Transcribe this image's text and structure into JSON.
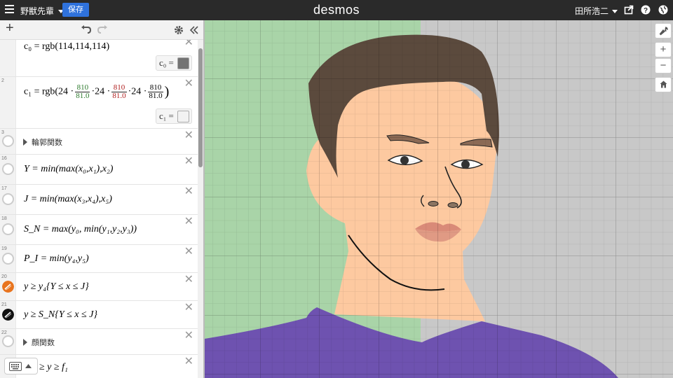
{
  "topbar": {
    "graph_name": "野獣先輩",
    "save_label": "保存",
    "logo": "desmos",
    "user_name": "田所浩二"
  },
  "expressions": [
    {
      "id": "",
      "latex": "c₀ = rgb(114,114,114)",
      "swatch_label": "c₀ =",
      "swatch_color": "#737373"
    },
    {
      "id": "2",
      "latex_prefix": "c₁ = rgb(24 ·",
      "frac_num": "810",
      "frac_den": "81.0",
      "latex_mid": "·24 ·",
      "latex_end": "·24 ·",
      "swatch_label": "c₁ =",
      "swatch_color": "#f2f2f2"
    },
    {
      "id": "3",
      "folder": "輪郭関数"
    },
    {
      "id": "16",
      "latex": "Y = min(max(x₀,x₁),x₂)"
    },
    {
      "id": "17",
      "latex": "J = min(max(x₃,x₄),x₅)"
    },
    {
      "id": "18",
      "latex": "S_N = max(y₀, min(y₁,y₂,y₃))"
    },
    {
      "id": "19",
      "latex": "P_I = min(y₄,y₅)"
    },
    {
      "id": "20",
      "latex": "y ≥ y₄{Y ≤ x ≤ J}",
      "icon_color": "#e8741e"
    },
    {
      "id": "21",
      "latex": "y ≥ S_N{Y ≤ x ≤ J}",
      "icon_color": "#111111"
    },
    {
      "id": "22",
      "folder": "顔関数"
    },
    {
      "id": "",
      "latex": "≥ y ≥ f₁"
    }
  ],
  "graph": {
    "colors": {
      "left_bg": "#a9d4a8",
      "right_bg": "#c8c8c8",
      "hair": "#5b4a3d",
      "skin": "#fdc9a0",
      "shirt": "#6e52b0",
      "lips": "#e09a84",
      "brow": "#8b6a55"
    }
  },
  "icons": {
    "menu": "hamburger-icon",
    "share": "share-icon",
    "help": "help-icon",
    "language": "globe-icon",
    "add": "plus-icon",
    "undo": "undo-icon",
    "redo": "redo-icon",
    "settings": "gear-icon",
    "collapse": "double-chevron-left-icon",
    "wrench": "wrench-icon",
    "zoom_in": "zoom-in-icon",
    "zoom_out": "zoom-out-icon",
    "home": "home-icon",
    "keyboard": "keyboard-icon"
  }
}
